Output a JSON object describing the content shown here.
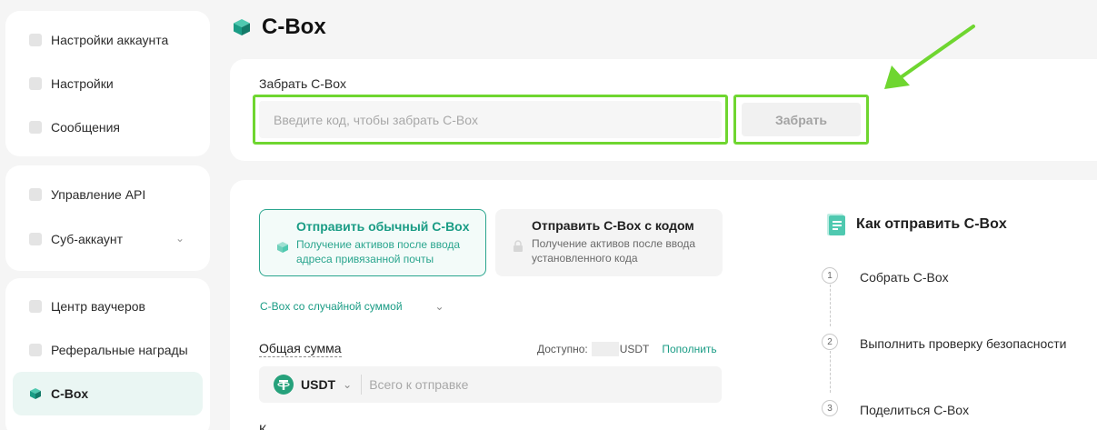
{
  "sidebar": {
    "group1": [
      {
        "label": "Настройки аккаунта",
        "icon": "user-icon"
      },
      {
        "label": "Настройки",
        "icon": "settings-icon"
      },
      {
        "label": "Сообщения",
        "icon": "message-icon"
      }
    ],
    "group2": [
      {
        "label": "Управление API",
        "icon": "api-icon"
      },
      {
        "label": "Суб-аккаунт",
        "icon": "sub-account-icon"
      }
    ],
    "group3": [
      {
        "label": "Центр ваучеров",
        "icon": "voucher-icon"
      },
      {
        "label": "Реферальные награды",
        "icon": "referral-icon"
      },
      {
        "label": "C-Box",
        "icon": "cbox-icon",
        "active": true
      }
    ]
  },
  "header": {
    "title": "C-Box"
  },
  "redeem": {
    "label": "Забрать C-Box",
    "placeholder": "Введите код, чтобы забрать C-Box",
    "button": "Забрать"
  },
  "send": {
    "options": [
      {
        "title": "Отправить обычный C-Box",
        "desc": "Получение активов после ввода адреса привязанной почты",
        "selected": true
      },
      {
        "title": "Отправить C-Box с кодом",
        "desc": "Получение активов после ввода установленного кода",
        "selected": false
      }
    ],
    "random_type": "C-Box со случайной суммой",
    "total_label": "Общая сумма",
    "available_label": "Доступно:",
    "available_currency": "USDT",
    "topup": "Пополнить",
    "currency": "USDT",
    "amount_placeholder": "Всего к отправке",
    "cut_label": "К"
  },
  "howto": {
    "title": "Как отправить C-Box",
    "steps": [
      {
        "num": "1",
        "text": "Собрать C-Box"
      },
      {
        "num": "2",
        "text": "Выполнить проверку безопасности"
      },
      {
        "num": "3",
        "text": "Поделиться C-Box"
      }
    ]
  },
  "colors": {
    "accent": "#1a9c85",
    "highlight": "#6fd630",
    "background": "#f5f5f5"
  }
}
